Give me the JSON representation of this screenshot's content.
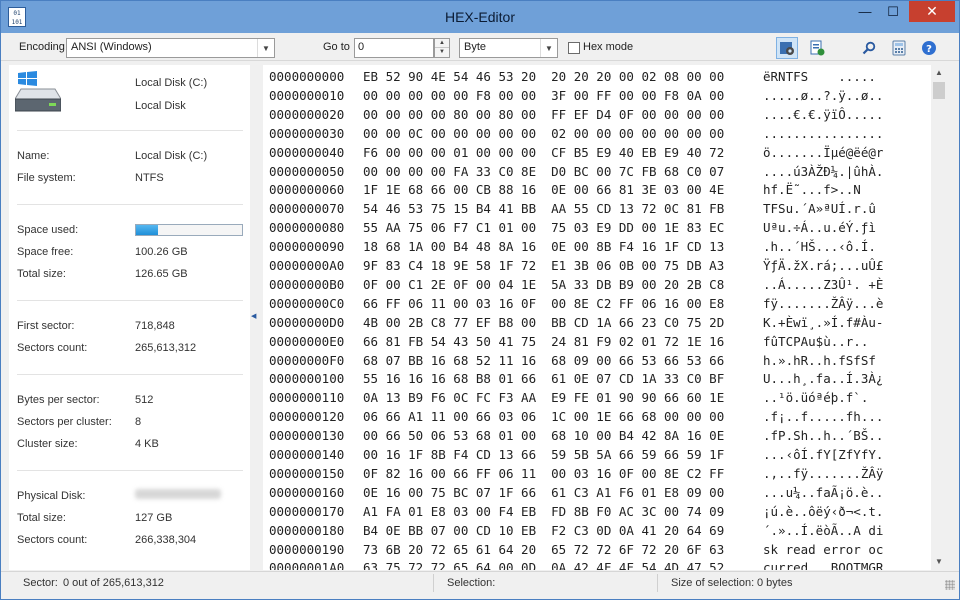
{
  "window": {
    "title": "HEX-Editor",
    "icon_text": "0|1\n101",
    "minimize_glyph": "—",
    "maximize_glyph": "☐",
    "close_glyph": "✕",
    "titlebar_color": "#6fa0d8",
    "close_color": "#c7402f"
  },
  "toolbar": {
    "encoding_label": "Encoding",
    "encoding_value": "ANSI (Windows)",
    "goto_label": "Go to",
    "goto_value": "0",
    "unit_value": "Byte",
    "hexmode_label": "Hex mode",
    "hexmode_checked": false,
    "icons": [
      "settings-gear-icon",
      "export-icon",
      "search-icon",
      "calculator-icon",
      "help-icon"
    ]
  },
  "disk_panel": {
    "drive_name": "Local Disk (C:)",
    "drive_label": "Local Disk",
    "name_label": "Name:",
    "name_value": "Local Disk (C:)",
    "fs_label": "File system:",
    "fs_value": "NTFS",
    "space_used_label": "Space used:",
    "space_used_fraction": 0.21,
    "space_free_label": "Space free:",
    "space_free_value": "100.26 GB",
    "total_size_label": "Total size:",
    "total_size_value": "126.65 GB",
    "first_sector_label": "First sector:",
    "first_sector_value": "718,848",
    "sectors_count_label": "Sectors count:",
    "sectors_count_value": "265,613,312",
    "bytes_per_sector_label": "Bytes per sector:",
    "bytes_per_sector_value": "512",
    "sectors_per_cluster_label": "Sectors per cluster:",
    "sectors_per_cluster_value": "8",
    "cluster_size_label": "Cluster size:",
    "cluster_size_value": "4 KB",
    "physical_disk_label": "Physical Disk:",
    "phys_total_size_label": "Total size:",
    "phys_total_size_value": "127 GB",
    "phys_sectors_count_label": "Sectors count:",
    "phys_sectors_count_value": "266,338,304"
  },
  "hex_rows": [
    {
      "offset": "0000000000",
      "bytes": "EB 52 90 4E 54 46 53 20  20 20 20 00 02 08 00 00",
      "ascii": "ëRNTFS    ....."
    },
    {
      "offset": "0000000010",
      "bytes": "00 00 00 00 00 F8 00 00  3F 00 FF 00 00 F8 0A 00",
      "ascii": ".....ø..?.ÿ..ø.."
    },
    {
      "offset": "0000000020",
      "bytes": "00 00 00 00 80 00 80 00  FF EF D4 0F 00 00 00 00",
      "ascii": "....€.€.ÿïÔ....."
    },
    {
      "offset": "0000000030",
      "bytes": "00 00 0C 00 00 00 00 00  02 00 00 00 00 00 00 00",
      "ascii": "................"
    },
    {
      "offset": "0000000040",
      "bytes": "F6 00 00 00 01 00 00 00  CF B5 E9 40 EB E9 40 72",
      "ascii": "ö.......Ïµé@ëé@r"
    },
    {
      "offset": "0000000050",
      "bytes": "00 00 00 00 FA 33 C0 8E  D0 BC 00 7C FB 68 C0 07",
      "ascii": "....ú3ÀŽÐ¼.|ûhÀ."
    },
    {
      "offset": "0000000060",
      "bytes": "1F 1E 68 66 00 CB 88 16  0E 00 66 81 3E 03 00 4E",
      "ascii": "hf.Ë˜...f>..N"
    },
    {
      "offset": "0000000070",
      "bytes": "54 46 53 75 15 B4 41 BB  AA 55 CD 13 72 0C 81 FB",
      "ascii": "TFSu.´A»ªUÍ.r.û"
    },
    {
      "offset": "0000000080",
      "bytes": "55 AA 75 06 F7 C1 01 00  75 03 E9 DD 00 1E 83 EC",
      "ascii": "Uªu.÷Á..u.éÝ.ƒì"
    },
    {
      "offset": "0000000090",
      "bytes": "18 68 1A 00 B4 48 8A 16  0E 00 8B F4 16 1F CD 13",
      "ascii": ".h..´HŠ...‹ô.Í."
    },
    {
      "offset": "00000000A0",
      "bytes": "9F 83 C4 18 9E 58 1F 72  E1 3B 06 0B 00 75 DB A3",
      "ascii": "ŸƒÄ.žX.rá;...uÛ£"
    },
    {
      "offset": "00000000B0",
      "bytes": "0F 00 C1 2E 0F 00 04 1E  5A 33 DB B9 00 20 2B C8",
      "ascii": "..Á.....Z3Û¹. +È"
    },
    {
      "offset": "00000000C0",
      "bytes": "66 FF 06 11 00 03 16 0F  00 8E C2 FF 06 16 00 E8",
      "ascii": "fÿ.......ŽÂÿ...è"
    },
    {
      "offset": "00000000D0",
      "bytes": "4B 00 2B C8 77 EF B8 00  BB CD 1A 66 23 C0 75 2D",
      "ascii": "K.+Èwï¸.»Í.f#Àu-"
    },
    {
      "offset": "00000000E0",
      "bytes": "66 81 FB 54 43 50 41 75  24 81 F9 02 01 72 1E 16",
      "ascii": "fûTCPAu$ù..r.."
    },
    {
      "offset": "00000000F0",
      "bytes": "68 07 BB 16 68 52 11 16  68 09 00 66 53 66 53 66",
      "ascii": "h.».hR..h.fSfSf"
    },
    {
      "offset": "0000000100",
      "bytes": "55 16 16 16 68 B8 01 66  61 0E 07 CD 1A 33 C0 BF",
      "ascii": "U...h¸.fa..Í.3À¿"
    },
    {
      "offset": "0000000110",
      "bytes": "0A 13 B9 F6 0C FC F3 AA  E9 FE 01 90 90 66 60 1E",
      "ascii": "..¹ö.üóªéþ.f`."
    },
    {
      "offset": "0000000120",
      "bytes": "06 66 A1 11 00 66 03 06  1C 00 1E 66 68 00 00 00",
      "ascii": ".f¡..f.....fh..."
    },
    {
      "offset": "0000000130",
      "bytes": "00 66 50 06 53 68 01 00  68 10 00 B4 42 8A 16 0E",
      "ascii": ".fP.Sh..h..´BŠ.."
    },
    {
      "offset": "0000000140",
      "bytes": "00 16 1F 8B F4 CD 13 66  59 5B 5A 66 59 66 59 1F",
      "ascii": "...‹ôÍ.fY[ZfYfY."
    },
    {
      "offset": "0000000150",
      "bytes": "0F 82 16 00 66 FF 06 11  00 03 16 0F 00 8E C2 FF",
      "ascii": ".‚..fÿ.......ŽÂÿ"
    },
    {
      "offset": "0000000160",
      "bytes": "0E 16 00 75 BC 07 1F 66  61 C3 A1 F6 01 E8 09 00",
      "ascii": "...u¼..faÃ¡ö.è.."
    },
    {
      "offset": "0000000170",
      "bytes": "A1 FA 01 E8 03 00 F4 EB  FD 8B F0 AC 3C 00 74 09",
      "ascii": "¡ú.è..ôëý‹ð¬<.t."
    },
    {
      "offset": "0000000180",
      "bytes": "B4 0E BB 07 00 CD 10 EB  F2 C3 0D 0A 41 20 64 69",
      "ascii": "´.»..Í.ëòÃ..A di"
    },
    {
      "offset": "0000000190",
      "bytes": "73 6B 20 72 65 61 64 20  65 72 72 6F 72 20 6F 63",
      "ascii": "sk read error oc"
    },
    {
      "offset": "00000001A0",
      "bytes": "63 75 72 72 65 64 00 0D  0A 42 4F 4F 54 4D 47 52",
      "ascii": "curred...BOOTMGR"
    }
  ],
  "statusbar": {
    "sector_label": "Sector:",
    "sector_value": "0 out of 265,613,312",
    "selection_label": "Selection:",
    "selection_size_label": "Size of selection:",
    "selection_size_value": "0 bytes"
  }
}
